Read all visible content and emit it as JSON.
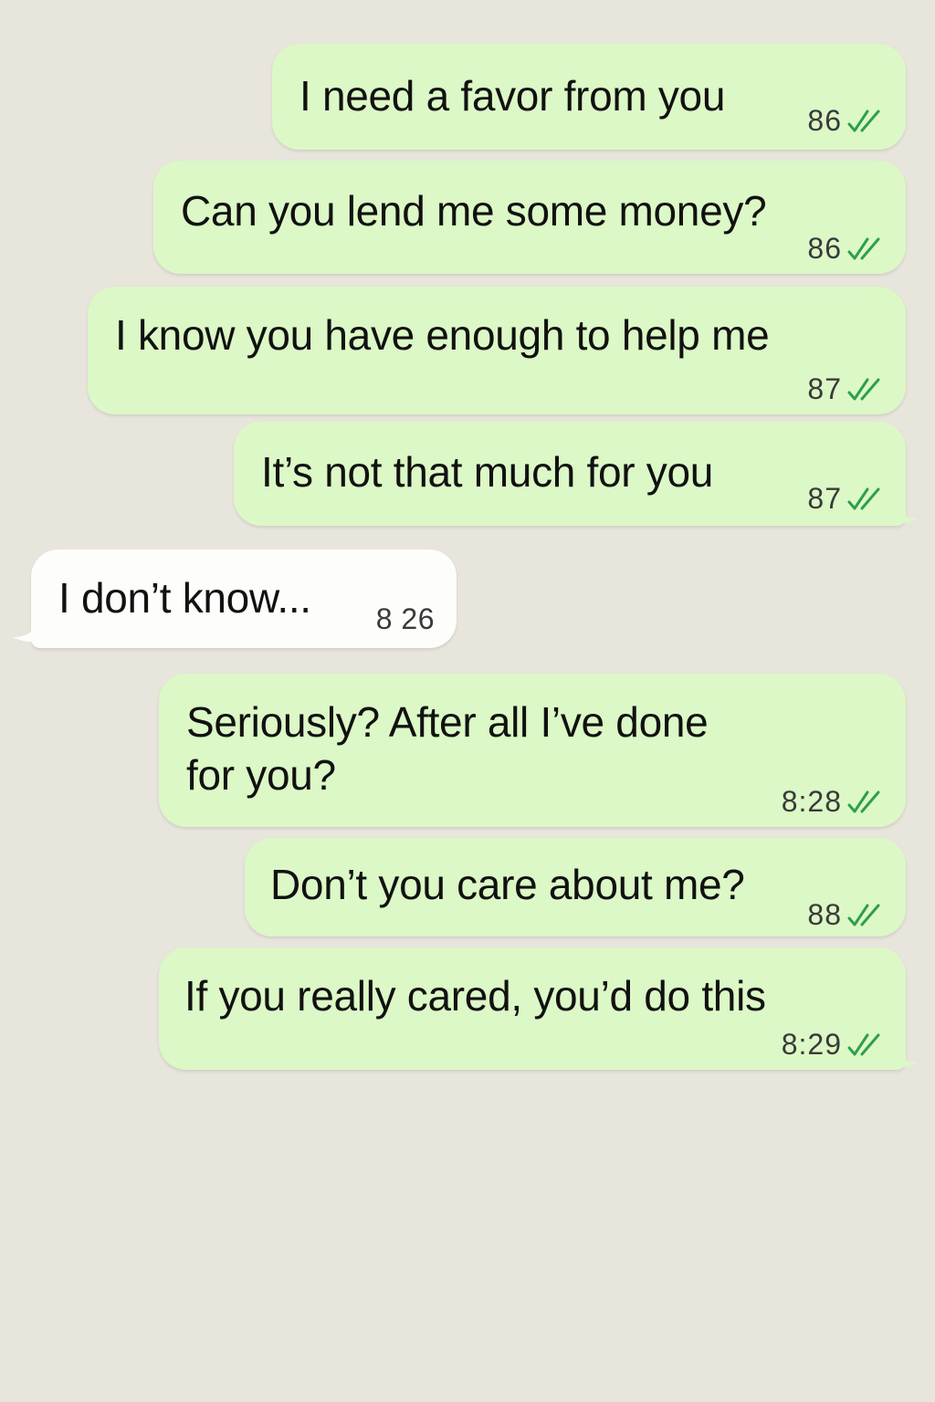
{
  "messages": [
    {
      "text": "I need a favor from you",
      "time": "86",
      "direction": "outgoing",
      "status": "read"
    },
    {
      "text": "Can you lend me some money?",
      "time": "86",
      "direction": "outgoing",
      "status": "read"
    },
    {
      "text": "I know you have enough to help me",
      "time": "87",
      "direction": "outgoing",
      "status": "read"
    },
    {
      "text": "It’s not that much for you",
      "time": "87",
      "direction": "outgoing",
      "status": "read"
    },
    {
      "text": "I don’t know...",
      "time": "8 26",
      "direction": "incoming"
    },
    {
      "text_line1": "Seriously? After all I’ve done",
      "text_line2": "for you?",
      "time": "8:28",
      "direction": "outgoing",
      "status": "read"
    },
    {
      "text": "Don’t you care about me?",
      "time": "88",
      "direction": "outgoing",
      "status": "read"
    },
    {
      "text": "If you really cared, you’d do this",
      "time": "8:29",
      "direction": "outgoing",
      "status": "read"
    }
  ],
  "colors": {
    "background": "#e8e5dc",
    "outgoing_bubble": "#dcf8c6",
    "incoming_bubble": "#fdfdfb",
    "read_tick": "#2e9e4f"
  },
  "icons": {
    "read_receipt": "double-check-icon"
  }
}
